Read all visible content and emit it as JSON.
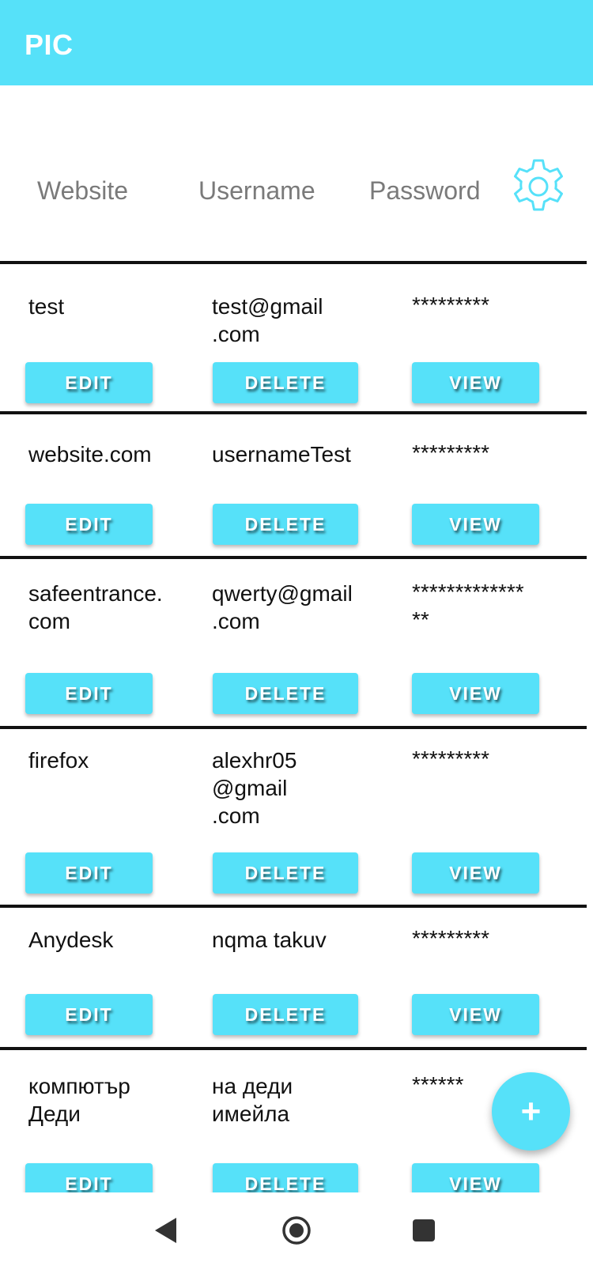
{
  "app": {
    "title": "PIC"
  },
  "header": {
    "website": "Website",
    "username": "Username",
    "password": "Password",
    "settings_icon": "gear-icon"
  },
  "buttons": {
    "edit": "EDIT",
    "delete": "DELETE",
    "view": "VIEW"
  },
  "entries": [
    {
      "website": "test",
      "username": "test@gmail\n.com",
      "password": "*********"
    },
    {
      "website": "website.com",
      "username": "usernameTest",
      "password": "*********"
    },
    {
      "website": "safeentrance.\ncom",
      "username": "qwerty@gmail\n.com",
      "password": "*************\n**"
    },
    {
      "website": "firefox",
      "username": "alexhr05\n@gmail\n.com",
      "password": "*********"
    },
    {
      "website": "Anydesk",
      "username": "nqma takuv",
      "password": "*********"
    },
    {
      "website": "компютър\nДеди",
      "username": "на деди\nимейла",
      "password": "******"
    }
  ],
  "fab": {
    "label": "+",
    "icon": "plus-icon"
  },
  "navbar": {
    "back_icon": "back-triangle-icon",
    "home_icon": "home-circle-icon",
    "recents_icon": "recents-square-icon"
  },
  "colors": {
    "accent": "#56e1f9",
    "header_text": "#7a7a7a",
    "divider": "#111111"
  }
}
